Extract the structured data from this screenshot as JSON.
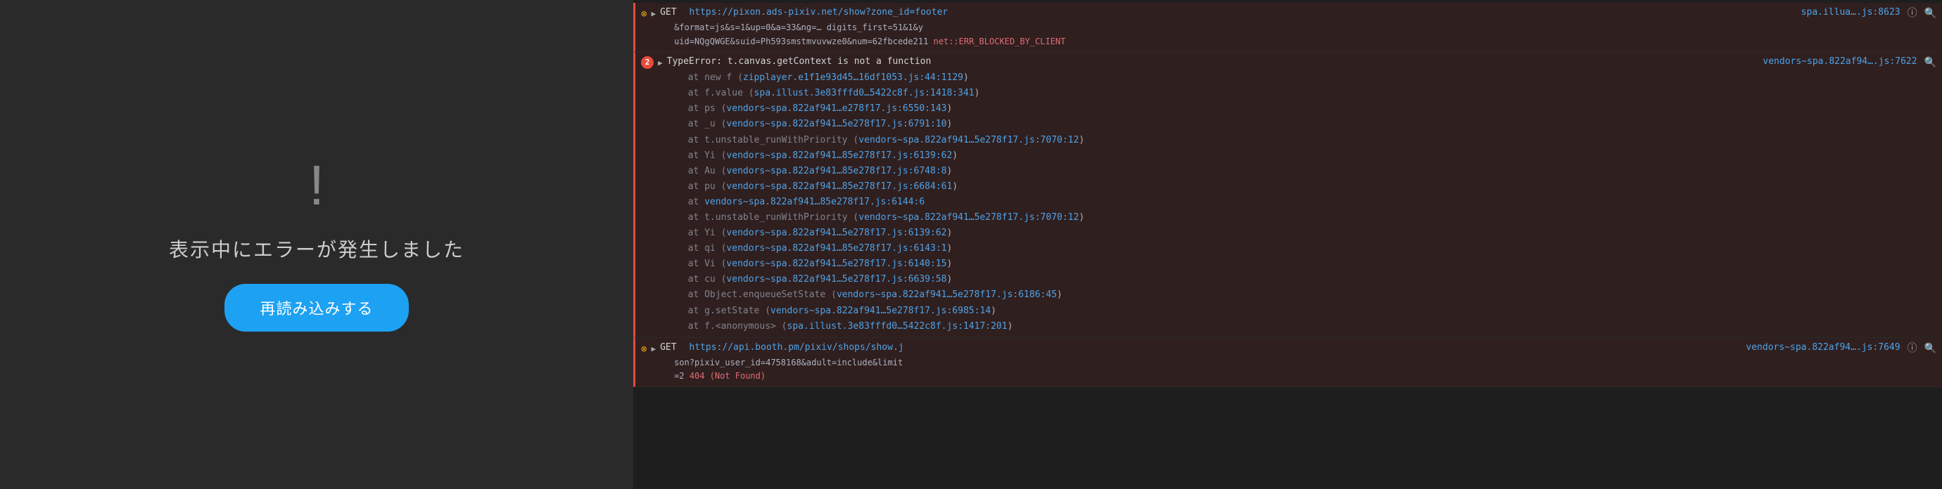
{
  "leftPanel": {
    "errorIcon": "!",
    "errorMessage": "表示中にエラーが発生しました",
    "reloadButton": "再読み込みする"
  },
  "console": {
    "entries": [
      {
        "type": "error",
        "id": "entry1",
        "kind": "network",
        "method": "GET",
        "url": "https://pixon.ads-pixiv.net/show?zone_id=footer",
        "urlDisplay": "https://pixon.ads-pixiv.net/show?zone_id=footer",
        "urlExtra": "&format=js&s=1&up=0&a=33&ng=… digits_first=51&1&y uid=NQgQWGE&suid=Ph593smstmvuvwze0&num=62fbcede211",
        "netError": "net::ERR_BLOCKED_BY_CLIENT",
        "rightRef": "spa.illua…js:8623",
        "icons": [
          "i-icon",
          "search-icon"
        ]
      },
      {
        "type": "error",
        "id": "entry2",
        "kind": "typeerror",
        "badge": "2",
        "errorTitle": "TypeError: t.canvas.getContext is not a function",
        "rightRef": "vendors~spa.822af94….js:7622",
        "stackTrace": [
          {
            "prefix": "at",
            "func": "new f",
            "fileRef": "zipplayer.e1f1e93d45…16df1053.js:44:1129",
            "fileHref": "zipplayer.e1f1e93d45…16df1053.js:44:1129"
          },
          {
            "prefix": "at",
            "func": "f.value",
            "fileRef": "spa.illust.3e83fffd0…5422c8f.js:1418:341",
            "fileHref": "spa.illust.3e83fffd0…5422c8f.js:1418:341"
          },
          {
            "prefix": "at",
            "func": "ps",
            "fileRef": "vendors~spa.822af941…e278f17.js:6550:143",
            "fileHref": "vendors~spa.822af941…e278f17.js:6550:143"
          },
          {
            "prefix": "at",
            "func": "_u",
            "fileRef": "vendors~spa.822af941…5e278f17.js:6791:10",
            "fileHref": "vendors~spa.822af941…5e278f17.js:6791:10"
          },
          {
            "prefix": "at",
            "func": "t.unstable_runWithPriority",
            "fileRef": "vendors~spa.822af941…5e278f17.js:7070:12",
            "fileHref": "vendors~spa.822af941…5e278f17.js:7070:12"
          },
          {
            "prefix": "at",
            "func": "Yi",
            "fileRef": "vendors~spa.822af941…85e278f17.js:6139:62",
            "fileHref": "vendors~spa.822af941…85e278f17.js:6139:62"
          },
          {
            "prefix": "at",
            "func": "Au",
            "fileRef": "vendors~spa.822af941…85e278f17.js:6748:8",
            "fileHref": "vendors~spa.822af941…85e278f17.js:6748:8"
          },
          {
            "prefix": "at",
            "func": "pu",
            "fileRef": "vendors~spa.822af941…85e278f17.js:6684:61",
            "fileHref": "vendors~spa.822af941…85e278f17.js:6684:61"
          },
          {
            "prefix": "at",
            "func": "",
            "fileRef": "vendors~spa.822af941…85e278f17.js:6144:6",
            "fileHref": "vendors~spa.822af941…85e278f17.js:6144:6",
            "noFunc": true
          },
          {
            "prefix": "at",
            "func": "t.unstable_runWithPriority",
            "fileRef": "vendors~spa.822af941…5e278f17.js:7070:12",
            "fileHref": "vendors~spa.822af941…5e278f17.js:7070:12"
          },
          {
            "prefix": "at",
            "func": "Yi",
            "fileRef": "vendors~spa.822af941…5e278f17.js:6139:62",
            "fileHref": "vendors~spa.822af941…5e278f17.js:6139:62"
          },
          {
            "prefix": "at",
            "func": "qi",
            "fileRef": "vendors~spa.822af941…85e278f17.js:6143:1",
            "fileHref": "vendors~spa.822af941…85e278f17.js:6143:1"
          },
          {
            "prefix": "at",
            "func": "Vi",
            "fileRef": "vendors~spa.822af941…5e278f17.js:6140:15",
            "fileHref": "vendors~spa.822af941…5e278f17.js:6140:15"
          },
          {
            "prefix": "at",
            "func": "cu",
            "fileRef": "vendors~spa.822af941…5e278f17.js:6639:58",
            "fileHref": "vendors~spa.822af941…5e278f17.js:6639:58"
          },
          {
            "prefix": "at",
            "func": "Object.enqueueSetState",
            "fileRef": "vendors~spa.822af941…5e278f17.js:6186:45",
            "fileHref": "vendors~spa.822af941…5e278f17.js:6186:45"
          },
          {
            "prefix": "at",
            "func": "g.setState",
            "fileRef": "vendors~spa.822af941…5e278f17.js:6985:14",
            "fileHref": "vendors~spa.822af941…5e278f17.js:6985:14"
          },
          {
            "prefix": "at",
            "func": "f.<anonymous>",
            "fileRef": "spa.illust.3e83fffd0…5422c8f.js:1417:201",
            "fileHref": "spa.illust.3e83fffd0…5422c8f.js:1417:201"
          }
        ]
      },
      {
        "type": "error",
        "id": "entry3",
        "kind": "network",
        "method": "GET",
        "url": "https://api.booth.pm/pixiv/shops/show.j",
        "urlDisplay": "https://api.booth.pm/pixiv/shops/show.j",
        "urlExtra": "son?pixiv_user_id=4758168&adult=include&limit =2",
        "httpError": "404 (Not Found)",
        "rightRef": "vendors~spa.822af94….js:7649",
        "icons": [
          "i-icon",
          "search-icon"
        ]
      }
    ]
  }
}
